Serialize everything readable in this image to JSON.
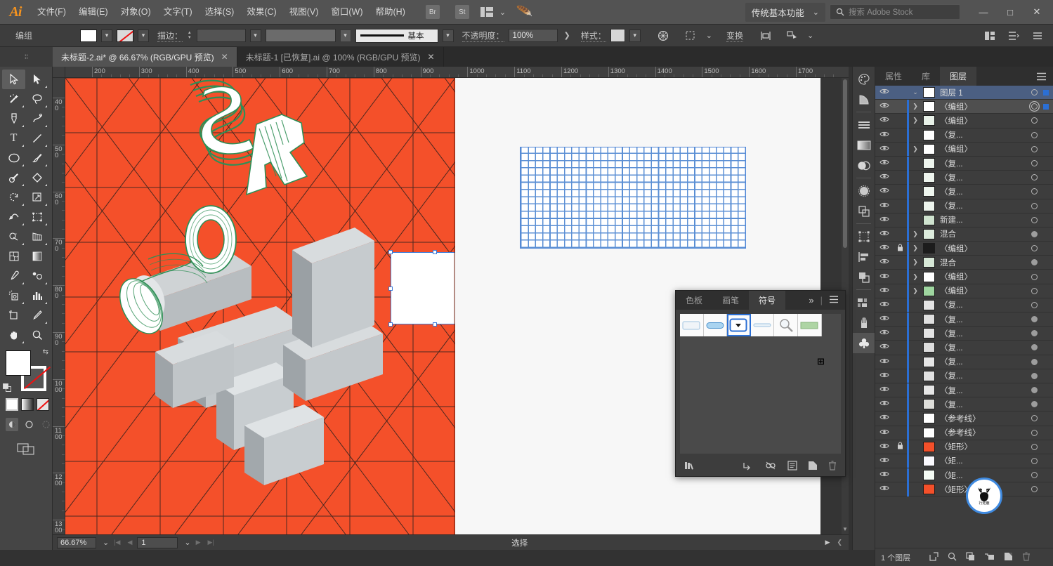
{
  "app": {
    "name": "Adobe Illustrator",
    "logo": "Ai"
  },
  "menu": {
    "items": [
      {
        "label": "文件(F)",
        "name": "menu-file"
      },
      {
        "label": "编辑(E)",
        "name": "menu-edit"
      },
      {
        "label": "对象(O)",
        "name": "menu-object"
      },
      {
        "label": "文字(T)",
        "name": "menu-type"
      },
      {
        "label": "选择(S)",
        "name": "menu-select"
      },
      {
        "label": "效果(C)",
        "name": "menu-effect"
      },
      {
        "label": "视图(V)",
        "name": "menu-view"
      },
      {
        "label": "窗口(W)",
        "name": "menu-window"
      },
      {
        "label": "帮助(H)",
        "name": "menu-help"
      }
    ],
    "bridge_badge": "Br",
    "stock_badge": "St",
    "workspace": "传统基本功能",
    "search_placeholder": "搜索 Adobe Stock",
    "window_minimize": "—",
    "window_maximize": "□",
    "window_close": "✕"
  },
  "control_bar": {
    "selection_label": "编组",
    "stroke_label": "描边：",
    "stroke_profile": "基本",
    "opacity_label": "不透明度：",
    "opacity_value": "100%",
    "style_label": "样式：",
    "transform_label": "变换",
    "fill_color": "#ffffff",
    "stroke_color": "none"
  },
  "tabs": [
    {
      "label": "未标题-2.ai* @ 66.67% (RGB/GPU 预览)",
      "active": true,
      "close": "✕"
    },
    {
      "label": "未标题-1 [已恢复].ai @ 100% (RGB/GPU 预览)",
      "active": false,
      "close": "✕"
    }
  ],
  "toolbar": {
    "tools": [
      {
        "name": "selection-tool",
        "selected": true
      },
      {
        "name": "direct-selection-tool",
        "selected": false
      },
      {
        "name": "magic-wand-tool",
        "selected": false
      },
      {
        "name": "lasso-tool",
        "selected": false
      },
      {
        "name": "pen-tool",
        "selected": false
      },
      {
        "name": "curvature-tool",
        "selected": false
      },
      {
        "name": "type-tool",
        "selected": false
      },
      {
        "name": "line-segment-tool",
        "selected": false
      },
      {
        "name": "ellipse-tool",
        "selected": false
      },
      {
        "name": "paintbrush-tool",
        "selected": false
      },
      {
        "name": "shaper-tool",
        "selected": false
      },
      {
        "name": "eraser-tool",
        "selected": false
      },
      {
        "name": "rotate-tool",
        "selected": false
      },
      {
        "name": "scale-tool",
        "selected": false
      },
      {
        "name": "width-tool",
        "selected": false
      },
      {
        "name": "free-transform-tool",
        "selected": false
      },
      {
        "name": "shape-builder-tool",
        "selected": false
      },
      {
        "name": "perspective-grid-tool",
        "selected": false
      },
      {
        "name": "mesh-tool",
        "selected": false
      },
      {
        "name": "gradient-tool",
        "selected": false
      },
      {
        "name": "eyedropper-tool",
        "selected": false
      },
      {
        "name": "blend-tool",
        "selected": false
      },
      {
        "name": "symbol-sprayer-tool",
        "selected": false
      },
      {
        "name": "column-graph-tool",
        "selected": false
      },
      {
        "name": "artboard-tool",
        "selected": false
      },
      {
        "name": "slice-tool",
        "selected": false
      },
      {
        "name": "hand-tool",
        "selected": false
      },
      {
        "name": "zoom-tool",
        "selected": false
      }
    ],
    "fill_color": "#ffffff",
    "stroke_color": "none",
    "mode_color": "color",
    "mode_gradient": "gradient",
    "mode_none": "none"
  },
  "rulers": {
    "horizontal": [
      "200",
      "300",
      "400",
      "500",
      "600",
      "700",
      "800",
      "900",
      "1000",
      "1100",
      "1200",
      "1300",
      "1400",
      "1500",
      "1600",
      "1700"
    ],
    "vertical": [
      "400",
      "500",
      "600",
      "700",
      "800",
      "900",
      "1000",
      "1100",
      "1200",
      "1300"
    ],
    "units": "px"
  },
  "canvas": {
    "artboard_color": "#f4502a",
    "selected_object": "E",
    "symbol_grid_color": "#5b8fd4",
    "selection_color": "#3b7ad9"
  },
  "status_bar": {
    "zoom": "66.67%",
    "artboard_number": "1",
    "status": "选择"
  },
  "right_dock": {
    "icons": [
      {
        "name": "color-panel-icon"
      },
      {
        "name": "color-guide-panel-icon"
      },
      {
        "name": "stroke-panel-icon"
      },
      {
        "name": "gradient-panel-icon"
      },
      {
        "name": "transparency-panel-icon"
      },
      {
        "name": "appearance-panel-icon"
      },
      {
        "name": "pathfinder-panel-icon"
      },
      {
        "name": "transform-panel-icon"
      },
      {
        "name": "align-panel-icon"
      },
      {
        "name": "layers-panel-icon"
      },
      {
        "name": "artboards-panel-icon"
      },
      {
        "name": "brushes-panel-icon"
      },
      {
        "name": "symbols-panel-icon",
        "selected": true
      }
    ]
  },
  "layers_panel": {
    "tabs": [
      {
        "label": "属性",
        "active": false
      },
      {
        "label": "库",
        "active": false
      },
      {
        "label": "图层",
        "active": true
      }
    ],
    "menu_icon": "hamburger-icon",
    "footer": {
      "count_label": "1 个图层"
    },
    "rows": [
      {
        "name": "图层 1",
        "type": "layer",
        "expand": "down",
        "lock": false,
        "thumb": "#ffffff",
        "target": "single",
        "selected": true,
        "highlight": "layer"
      },
      {
        "name": "〈编组〉",
        "type": "group",
        "expand": "right",
        "lock": false,
        "thumb": "#ffffff",
        "target": "double",
        "selected": true,
        "highlight": "row"
      },
      {
        "name": "〈编组〉",
        "type": "group",
        "expand": "right",
        "lock": false,
        "thumb": "#e9f2e9",
        "target": "single",
        "selected": false
      },
      {
        "name": "〈复...",
        "type": "path",
        "expand": "none",
        "lock": false,
        "thumb": "#ffffff",
        "target": "single",
        "selected": false
      },
      {
        "name": "〈编组〉",
        "type": "group",
        "expand": "right",
        "lock": false,
        "thumb": "#ffffff",
        "target": "single",
        "selected": false
      },
      {
        "name": "〈复...",
        "type": "path",
        "expand": "none",
        "lock": false,
        "thumb": "#eef5ee",
        "target": "single",
        "selected": false
      },
      {
        "name": "〈复...",
        "type": "path",
        "expand": "none",
        "lock": false,
        "thumb": "#eef5ee",
        "target": "single",
        "selected": false
      },
      {
        "name": "〈复...",
        "type": "path",
        "expand": "none",
        "lock": false,
        "thumb": "#eef5ee",
        "target": "single",
        "selected": false
      },
      {
        "name": "〈复...",
        "type": "path",
        "expand": "none",
        "lock": false,
        "thumb": "#eef5ee",
        "target": "single",
        "selected": false
      },
      {
        "name": "新建...",
        "type": "path",
        "expand": "none",
        "lock": false,
        "thumb": "#cfe3cf",
        "target": "single",
        "selected": false
      },
      {
        "name": "混合",
        "type": "blend",
        "expand": "right",
        "lock": false,
        "thumb": "#dcebdc",
        "target": "filled",
        "selected": false
      },
      {
        "name": "〈编组〉",
        "type": "group",
        "expand": "right",
        "lock": true,
        "thumb": "#1c1c1c",
        "target": "single",
        "selected": false
      },
      {
        "name": "混合",
        "type": "blend",
        "expand": "right",
        "lock": false,
        "thumb": "#d7e8d7",
        "target": "filled",
        "selected": false
      },
      {
        "name": "〈编组〉",
        "type": "group",
        "expand": "right",
        "lock": false,
        "thumb": "#ffffff",
        "target": "single",
        "selected": false
      },
      {
        "name": "〈编组〉",
        "type": "group",
        "expand": "right",
        "lock": false,
        "thumb": "#9fd6a0",
        "target": "single",
        "selected": false
      },
      {
        "name": "〈复...",
        "type": "path",
        "expand": "none",
        "lock": false,
        "thumb": "#e4e4e4",
        "target": "single",
        "selected": false
      },
      {
        "name": "〈复...",
        "type": "path",
        "expand": "none",
        "lock": false,
        "thumb": "#e0e0e0",
        "target": "filled",
        "selected": false
      },
      {
        "name": "〈复...",
        "type": "path",
        "expand": "none",
        "lock": false,
        "thumb": "#e4e4e4",
        "target": "filled",
        "selected": false
      },
      {
        "name": "〈复...",
        "type": "path",
        "expand": "none",
        "lock": false,
        "thumb": "#dddddd",
        "target": "filled",
        "selected": false
      },
      {
        "name": "〈复...",
        "type": "path",
        "expand": "none",
        "lock": false,
        "thumb": "#e6e6e6",
        "target": "filled",
        "selected": false
      },
      {
        "name": "〈复...",
        "type": "path",
        "expand": "none",
        "lock": false,
        "thumb": "#e2e2e2",
        "target": "filled",
        "selected": false
      },
      {
        "name": "〈复...",
        "type": "path",
        "expand": "none",
        "lock": false,
        "thumb": "#e6e6e6",
        "target": "filled",
        "selected": false
      },
      {
        "name": "〈复...",
        "type": "path",
        "expand": "none",
        "lock": false,
        "thumb": "#dededa",
        "target": "filled",
        "selected": false
      },
      {
        "name": "〈参考线〉",
        "type": "guide",
        "expand": "none",
        "lock": false,
        "thumb": "#ffffff",
        "target": "single",
        "selected": false
      },
      {
        "name": "〈参考线〉",
        "type": "guide",
        "expand": "none",
        "lock": false,
        "thumb": "#ffffff",
        "target": "single",
        "selected": false
      },
      {
        "name": "〈矩形〉",
        "type": "rect",
        "expand": "none",
        "lock": true,
        "thumb": "#f4502a",
        "target": "single",
        "selected": false
      },
      {
        "name": "〈矩...",
        "type": "rect",
        "expand": "none",
        "lock": false,
        "thumb": "#fbfaff",
        "target": "single",
        "selected": false
      },
      {
        "name": "〈矩...",
        "type": "rect",
        "expand": "none",
        "lock": false,
        "thumb": "#f4fbf4",
        "target": "single",
        "selected": false
      },
      {
        "name": "〈矩形〉",
        "type": "rect",
        "expand": "none",
        "lock": false,
        "thumb": "#f4502a",
        "target": "single",
        "selected": false
      }
    ]
  },
  "symbols_panel": {
    "tabs": [
      {
        "label": "色板",
        "active": false
      },
      {
        "label": "画笔",
        "active": false
      },
      {
        "label": "符号",
        "active": true
      }
    ],
    "collapse_icon": "»",
    "menu_icon": "hamburger-icon",
    "symbols": [
      {
        "name": "symbol-rounded-rect",
        "selected": false
      },
      {
        "name": "symbol-blue-pill",
        "selected": false
      },
      {
        "name": "symbol-dropdown-button",
        "selected": true
      },
      {
        "name": "symbol-thin-field",
        "selected": false
      },
      {
        "name": "symbol-magnifier",
        "selected": false
      },
      {
        "name": "symbol-green-bar",
        "selected": false
      }
    ],
    "footer_icons": [
      {
        "name": "symbol-libraries-icon"
      },
      {
        "name": "place-symbol-instance-icon"
      },
      {
        "name": "break-link-icon"
      },
      {
        "name": "symbol-options-icon"
      },
      {
        "name": "new-symbol-icon"
      },
      {
        "name": "delete-symbol-icon"
      }
    ]
  },
  "watermark": {
    "text": "行走鹿"
  }
}
